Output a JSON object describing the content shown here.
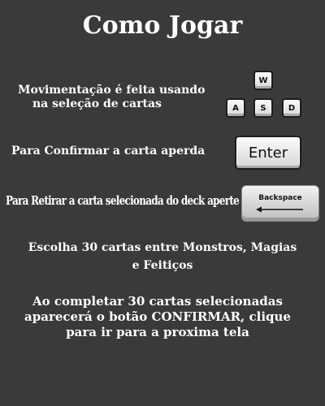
{
  "title": "Como Jogar",
  "movement": {
    "line1": "Movimentação é feita usando",
    "line2": "na seleção de cartas",
    "keys": [
      "W",
      "A",
      "S",
      "D"
    ]
  },
  "confirm": {
    "text": "Para Confirmar a carta aperda",
    "key_label": "Enter"
  },
  "remove": {
    "text": "Para Retirar a carta selecionada do deck aperte",
    "key_label": "Backspace"
  },
  "choose": {
    "line1": "Escolha 30 cartas entre Monstros, Magias",
    "line2": "e Feitiços"
  },
  "complete": {
    "line1": "Ao completar 30 cartas selecionadas",
    "line2": "aparecerá o botão CONFIRMAR, clique",
    "line3": "para ir para a proxima tela"
  },
  "colors": {
    "background": "#3a3a3a",
    "text": "#ffffff",
    "key_face": "#f2f2f2"
  }
}
